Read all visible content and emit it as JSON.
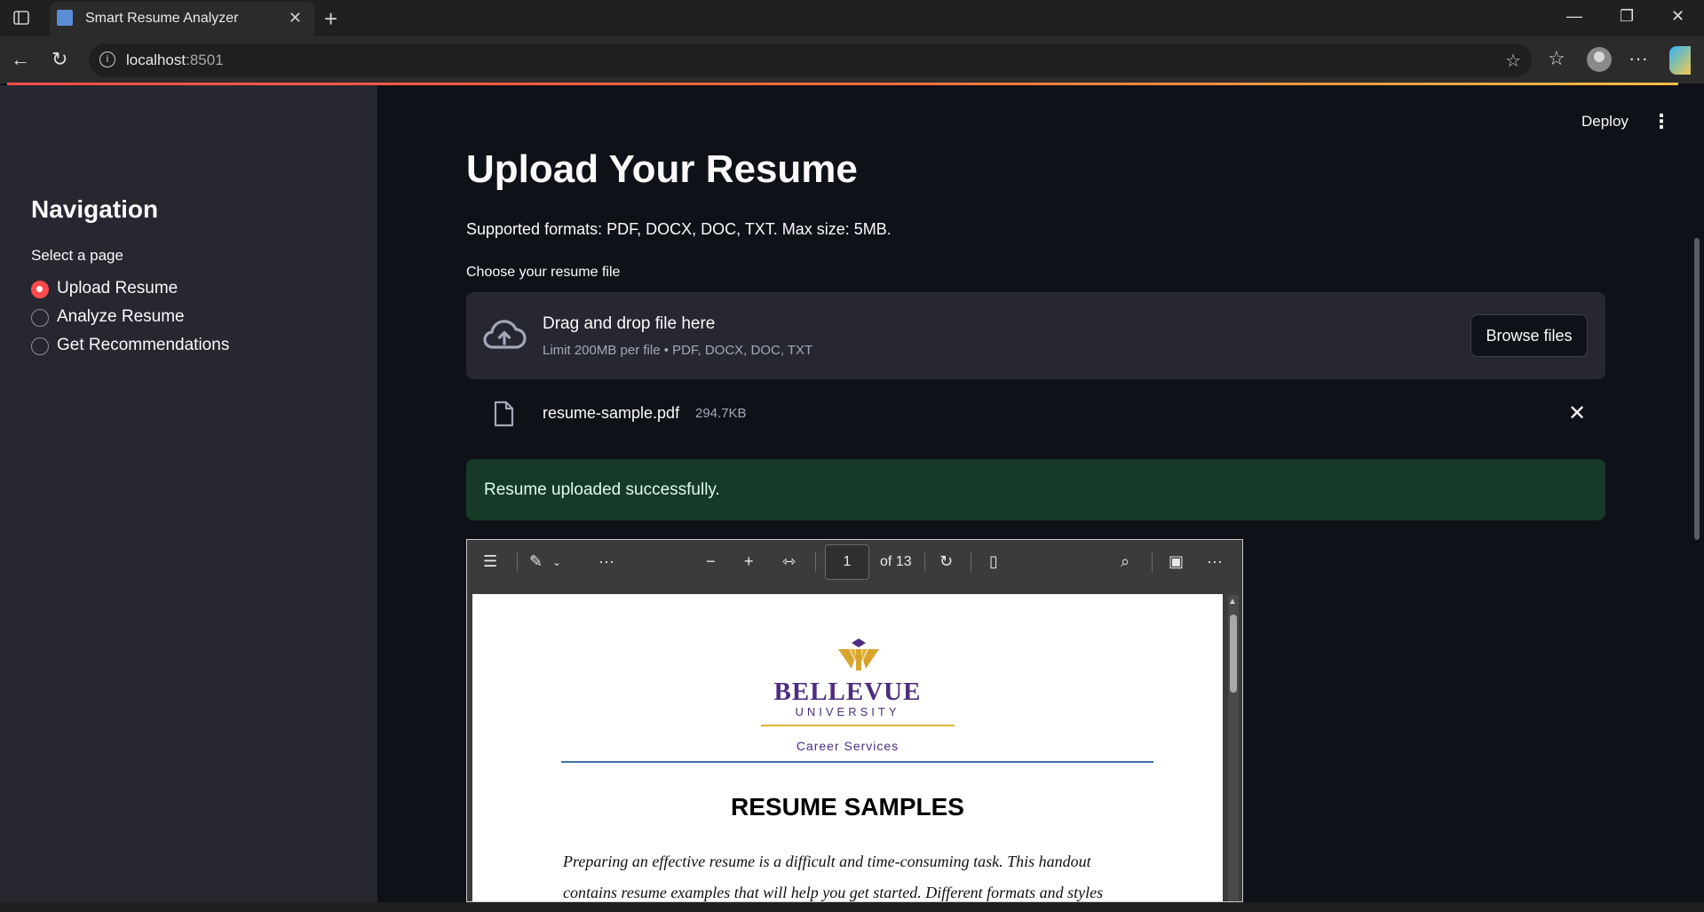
{
  "browser": {
    "tab_title": "Smart Resume Analyzer",
    "url_host": "localhost",
    "url_port": ":8501"
  },
  "header": {
    "deploy_label": "Deploy"
  },
  "sidebar": {
    "title": "Navigation",
    "select_label": "Select a page",
    "options": [
      {
        "label": "Upload Resume",
        "selected": true
      },
      {
        "label": "Analyze Resume",
        "selected": false
      },
      {
        "label": "Get Recommendations",
        "selected": false
      }
    ]
  },
  "main": {
    "title": "Upload Your Resume",
    "formats_text": "Supported formats: PDF, DOCX, DOC, TXT. Max size: 5MB.",
    "uploader_label": "Choose your resume file",
    "dropzone_main": "Drag and drop file here",
    "dropzone_sub": "Limit 200MB per file • PDF, DOCX, DOC, TXT",
    "browse_label": "Browse files",
    "file_name": "resume-sample.pdf",
    "file_size": "294.7KB",
    "success_message": "Resume uploaded successfully."
  },
  "pdf_viewer": {
    "current_page": "1",
    "page_total_text": "of 13",
    "document": {
      "logo_name": "BELLEVUE",
      "logo_sub": "UNIVERSITY",
      "department": "Career Services",
      "title": "RESUME SAMPLES",
      "paragraph_line1": "Preparing an effective resume is a difficult and time-consuming task.  This handout",
      "paragraph_line2": "contains resume examples that will help you get started.  Different formats and styles"
    }
  },
  "colors": {
    "accent": "#ff4b4b",
    "success_bg": "#173928",
    "sidebar_bg": "#262730",
    "main_bg": "#0e1117",
    "brand_purple": "#4e2d7f",
    "brand_gold": "#e1b33a"
  }
}
